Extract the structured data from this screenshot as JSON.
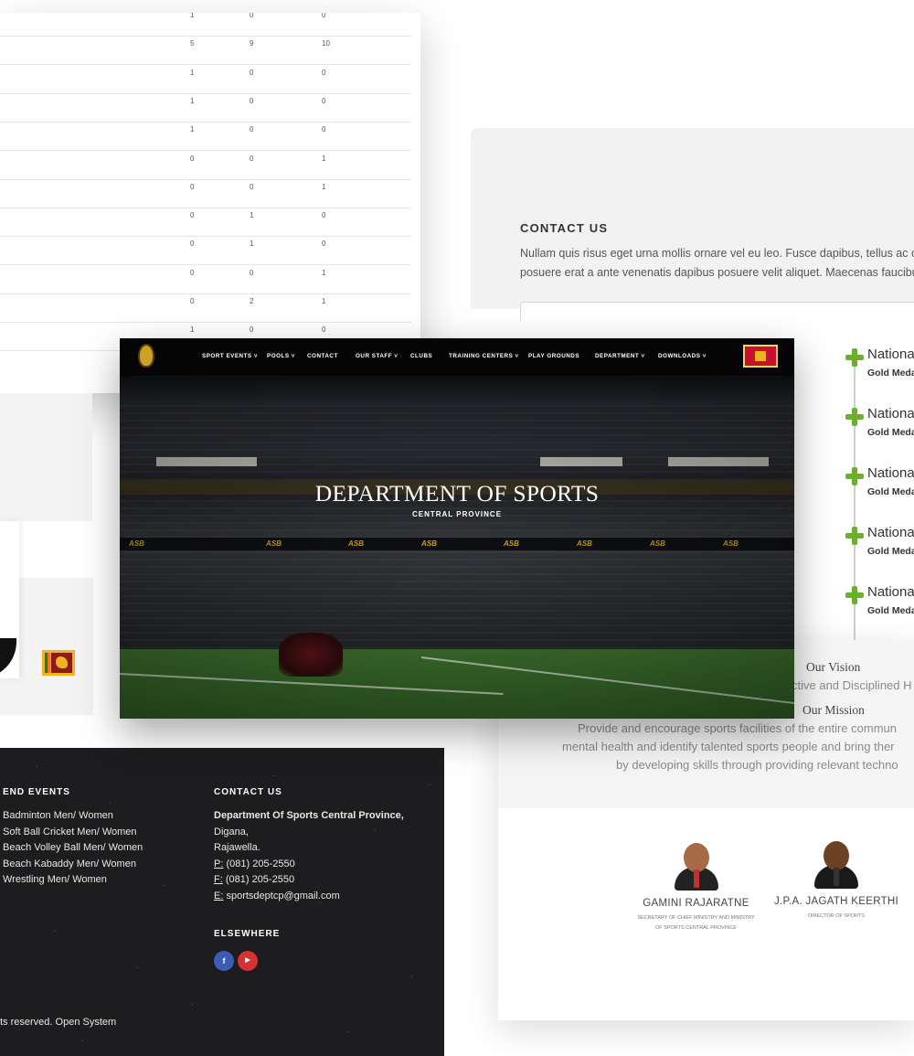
{
  "table": {
    "rows": [
      [
        "1",
        "0",
        "0"
      ],
      [
        "5",
        "9",
        "10"
      ],
      [
        "1",
        "0",
        "0"
      ],
      [
        "1",
        "0",
        "0"
      ],
      [
        "1",
        "0",
        "0"
      ],
      [
        "0",
        "0",
        "1"
      ],
      [
        "0",
        "0",
        "1"
      ],
      [
        "0",
        "1",
        "0"
      ],
      [
        "0",
        "1",
        "0"
      ],
      [
        "0",
        "0",
        "1"
      ],
      [
        "0",
        "2",
        "1"
      ],
      [
        "1",
        "0",
        "0"
      ]
    ]
  },
  "contact_section": {
    "title": "CONTACT US",
    "text_line1": "Nullam quis risus eget urna mollis ornare vel eu leo. Fusce dapibus, tellus ac curs",
    "text_line2": "posuere erat a ante venenatis dapibus posuere velit aliquet. Maecenas faucibus"
  },
  "timeline": {
    "items": [
      {
        "title": "Nationa",
        "sub": "Gold Meda"
      },
      {
        "title": "Nationa",
        "sub": "Gold Meda"
      },
      {
        "title": "Nationa",
        "sub": "Gold Meda"
      },
      {
        "title": "Nationa",
        "sub": "Gold Meda"
      },
      {
        "title": "Nationa",
        "sub": "Gold Meda"
      }
    ],
    "accent_color": "#6bb02b"
  },
  "hero": {
    "nav": [
      "SPORT EVENTS",
      "POOLS",
      "CONTACT",
      "OUR STAFF",
      "CLUBS",
      "TRAINING CENTERS",
      "PLAY GROUNDS",
      "DEPARTMENT",
      "DOWNLOADS"
    ],
    "title": "DEPARTMENT OF SPORTS",
    "subtitle": "CENTRAL PROVINCE",
    "board_text": "ASB"
  },
  "vision": {
    "vision_heading": "Our Vision",
    "vision_text": "ctive and Disciplined H",
    "mission_heading": "Our Mission",
    "mission_line1": "Provide and encourage sports facilities of the entire commun",
    "mission_line2": "mental health and identify talented sports people and bring ther",
    "mission_line3": "by developing skills through providing relevant techno"
  },
  "staff": [
    {
      "name": "GAMINI RAJARATNE",
      "role_line1": "SECRETARY OF CHIEF MINISTRY AND MINISTRY",
      "role_line2": "OF SPORTS CENTRAL PROVINCE"
    },
    {
      "name": "J.P.A. JAGATH KEERTHI",
      "role_line1": "DIRECTOR OF SPORTS",
      "role_line2": ""
    }
  ],
  "footer": {
    "events_heading": "END EVENTS",
    "events": [
      "Badminton Men/ Women",
      "Soft Ball Cricket Men/ Women",
      "Beach Volley Ball Men/ Women",
      "Beach Kabaddy Men/ Women",
      "Wrestling Men/ Women"
    ],
    "contact_heading": "CONTACT US",
    "org": "Department Of Sports Central Province,",
    "addr1": "Digana,",
    "addr2": "Rajawella.",
    "phone_label": "P:",
    "phone": " (081) 205-2550",
    "fax_label": "F:",
    "fax": " (081) 205-2550",
    "email_label": "E:",
    "email": " sportsdeptcp@gmail.com",
    "elsewhere_heading": "ELSEWHERE",
    "facebook_icon": "f",
    "youtube_icon": "▶",
    "copyright": "ts reserved. Open System"
  }
}
